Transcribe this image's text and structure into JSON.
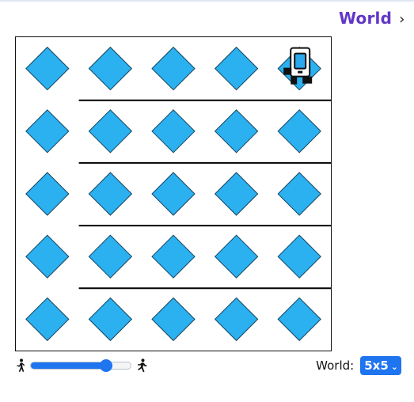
{
  "header": {
    "world_link_label": "World",
    "chevron_icon": "chevron-right-icon"
  },
  "board": {
    "rows": 5,
    "cols": 5,
    "item_shape": "diamond",
    "item_color": "#2bb0f0",
    "item_outline": "#13435d",
    "wall_color": "#000000",
    "robot": {
      "row": 1,
      "col": 5,
      "icon": "robot-icon"
    },
    "beepers": [
      {
        "row": 1,
        "col": 1
      },
      {
        "row": 1,
        "col": 2
      },
      {
        "row": 1,
        "col": 3
      },
      {
        "row": 1,
        "col": 4
      },
      {
        "row": 1,
        "col": 5
      },
      {
        "row": 2,
        "col": 1
      },
      {
        "row": 2,
        "col": 2
      },
      {
        "row": 2,
        "col": 3
      },
      {
        "row": 2,
        "col": 4
      },
      {
        "row": 2,
        "col": 5
      },
      {
        "row": 3,
        "col": 1
      },
      {
        "row": 3,
        "col": 2
      },
      {
        "row": 3,
        "col": 3
      },
      {
        "row": 3,
        "col": 4
      },
      {
        "row": 3,
        "col": 5
      },
      {
        "row": 4,
        "col": 1
      },
      {
        "row": 4,
        "col": 2
      },
      {
        "row": 4,
        "col": 3
      },
      {
        "row": 4,
        "col": 4
      },
      {
        "row": 4,
        "col": 5
      },
      {
        "row": 5,
        "col": 1
      },
      {
        "row": 5,
        "col": 2
      },
      {
        "row": 5,
        "col": 3
      },
      {
        "row": 5,
        "col": 4
      },
      {
        "row": 5,
        "col": 5
      }
    ],
    "walls": [
      {
        "between_rows": [
          1,
          2
        ],
        "from_col": 2,
        "to_col": 5
      },
      {
        "between_rows": [
          2,
          3
        ],
        "from_col": 2,
        "to_col": 5
      },
      {
        "between_rows": [
          3,
          4
        ],
        "from_col": 2,
        "to_col": 5
      },
      {
        "between_rows": [
          4,
          5
        ],
        "from_col": 2,
        "to_col": 5
      }
    ]
  },
  "controls": {
    "speed_slow_icon": "walking-person-icon",
    "speed_fast_icon": "running-person-icon",
    "speed_value": 0.75,
    "world_label": "World:",
    "world_selected": "5x5",
    "world_chevron_icon": "chevron-down-icon"
  },
  "colors": {
    "accent": "#1f74ef",
    "title": "#6236c6"
  }
}
